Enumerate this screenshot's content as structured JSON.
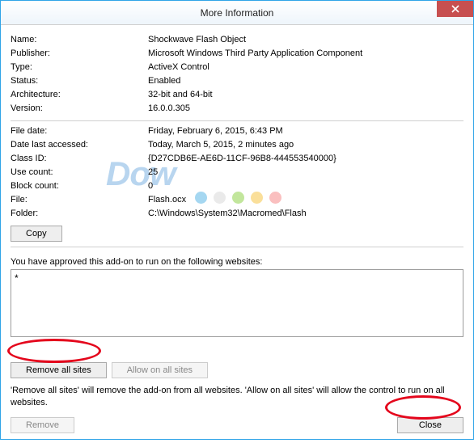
{
  "window": {
    "title": "More Information"
  },
  "fields": {
    "name_label": "Name:",
    "name_value": "Shockwave Flash Object",
    "publisher_label": "Publisher:",
    "publisher_value": "Microsoft Windows Third Party Application Component",
    "type_label": "Type:",
    "type_value": "ActiveX Control",
    "status_label": "Status:",
    "status_value": "Enabled",
    "arch_label": "Architecture:",
    "arch_value": "32-bit and 64-bit",
    "version_label": "Version:",
    "version_value": "16.0.0.305",
    "filedate_label": "File date:",
    "filedate_value": "Friday, February 6, 2015, 6:43 PM",
    "accessed_label": "Date last accessed:",
    "accessed_value": "Today, March 5, 2015, 2 minutes ago",
    "classid_label": "Class ID:",
    "classid_value": "{D27CDB6E-AE6D-11CF-96B8-444553540000}",
    "usecount_label": "Use count:",
    "usecount_value": "25",
    "blockcount_label": "Block count:",
    "blockcount_value": "0",
    "file_label": "File:",
    "file_value": "Flash.ocx",
    "folder_label": "Folder:",
    "folder_value": "C:\\Windows\\System32\\Macromed\\Flash"
  },
  "buttons": {
    "copy": "Copy",
    "remove_all": "Remove all sites",
    "allow_all": "Allow on all sites",
    "remove": "Remove",
    "close": "Close"
  },
  "text": {
    "approved": "You have approved this add-on to run on the following websites:",
    "sites_value": "*",
    "note": "'Remove all sites' will remove the add-on from all websites. 'Allow on all sites' will allow the control to run on all websites."
  },
  "watermark": {
    "text": "Dow",
    "dot_colors": [
      "#5bb7e6",
      "#d8d8d8",
      "#8fd14b",
      "#f5c447",
      "#f58a8a"
    ]
  }
}
